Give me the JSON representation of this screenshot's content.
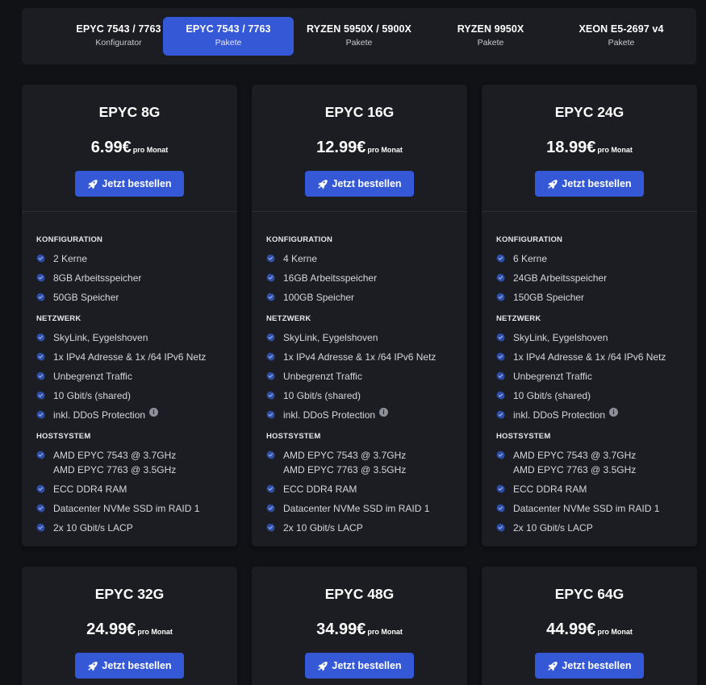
{
  "tabs": [
    {
      "title": "EPYC 7543 / 7763",
      "sub": "Konfigurator"
    },
    {
      "title": "EPYC 7543 / 7763",
      "sub": "Pakete"
    },
    {
      "title": "RYZEN 5950X / 5900X",
      "sub": "Pakete"
    },
    {
      "title": "RYZEN 9950X",
      "sub": "Pakete"
    },
    {
      "title": "XEON E5-2697 v4",
      "sub": "Pakete"
    }
  ],
  "per_label": "pro Monat",
  "order_label": "Jetzt bestellen",
  "sections": {
    "config": "KONFIGURATION",
    "network": "NETZWERK",
    "host": "HOSTSYSTEM"
  },
  "network": [
    "SkyLink, Eygelshoven",
    "1x IPv4 Adresse & 1x /64 IPv6 Netz",
    "Unbegrenzt Traffic",
    "10 Gbit/s (shared)",
    "inkl. DDoS Protection"
  ],
  "host": [
    "AMD EPYC 7543 @ 3.7GHz",
    "AMD EPYC 7763 @ 3.5GHz",
    "ECC DDR4 RAM",
    "Datacenter NVMe SSD im RAID 1",
    "2x 10 Gbit/s LACP"
  ],
  "info_glyph": "i",
  "plans": [
    {
      "name": "EPYC 8G",
      "price": "6.99€",
      "config": [
        "2 Kerne",
        "8GB Arbeitsspeicher",
        "50GB Speicher"
      ]
    },
    {
      "name": "EPYC 16G",
      "price": "12.99€",
      "config": [
        "4 Kerne",
        "16GB Arbeitsspeicher",
        "100GB Speicher"
      ]
    },
    {
      "name": "EPYC 24G",
      "price": "18.99€",
      "config": [
        "6 Kerne",
        "24GB Arbeitsspeicher",
        "150GB Speicher"
      ]
    },
    {
      "name": "EPYC 32G",
      "price": "24.99€"
    },
    {
      "name": "EPYC 48G",
      "price": "34.99€"
    },
    {
      "name": "EPYC 64G",
      "price": "44.99€"
    }
  ],
  "colors": {
    "accent": "#3559d6",
    "card": "#1c1d22",
    "background": "#111216"
  }
}
